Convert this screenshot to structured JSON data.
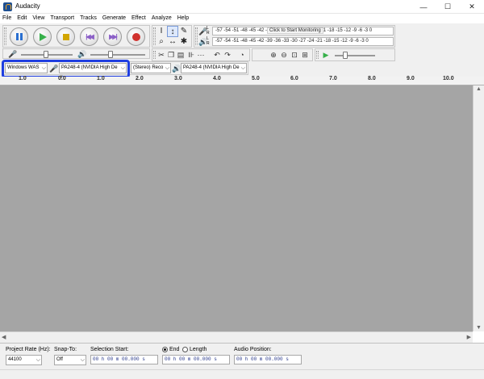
{
  "window": {
    "title": "Audacity",
    "minimize": "—",
    "maximize": "☐",
    "close": "✕"
  },
  "menu": [
    "File",
    "Edit",
    "View",
    "Transport",
    "Tracks",
    "Generate",
    "Effect",
    "Analyze",
    "Help"
  ],
  "meters": {
    "record_scale": "-57 -54 -51 -48 -45 -42 -",
    "monitor_label": "Click to Start Monitoring",
    "record_scale_tail": "1 -18 -15 -12 -9 -6 -3 0",
    "playback_scale": "-57 -54 -51 -48 -45 -42 -39 -36 -33 -30 -27 -24 -21 -18 -15 -12 -9 -6 -3 0",
    "record_channels": "L R",
    "playback_channels": "L R"
  },
  "device_toolbar": {
    "host": "Windows WAS",
    "recording_device": "PA248-4 (NVIDIA High De",
    "channels": "(Stereo) Reco",
    "playback_device": "PA248-4 (NVIDIA High De"
  },
  "ruler": {
    "ticks": [
      "1.0",
      "0.0",
      "1.0",
      "2.0",
      "3.0",
      "4.0",
      "5.0",
      "6.0",
      "7.0",
      "8.0",
      "9.0",
      "10.0"
    ],
    "start_marker": "▼"
  },
  "selection_toolbar": {
    "project_rate_label": "Project Rate (Hz):",
    "project_rate_value": "44100",
    "snap_to_label": "Snap-To:",
    "snap_to_value": "Off",
    "selection_start_label": "Selection Start:",
    "selection_start_value": "00 h 00 m 00.000 s",
    "end_label": "End",
    "length_label": "Length",
    "end_value": "00 h 00 m 00.000 s",
    "audio_position_label": "Audio Position:",
    "audio_position_value": "00 h 00 m 00.000 s",
    "end_selected": true
  },
  "colors": {
    "highlight": "#1f3ee0",
    "workspace": "#a5a5a5"
  }
}
